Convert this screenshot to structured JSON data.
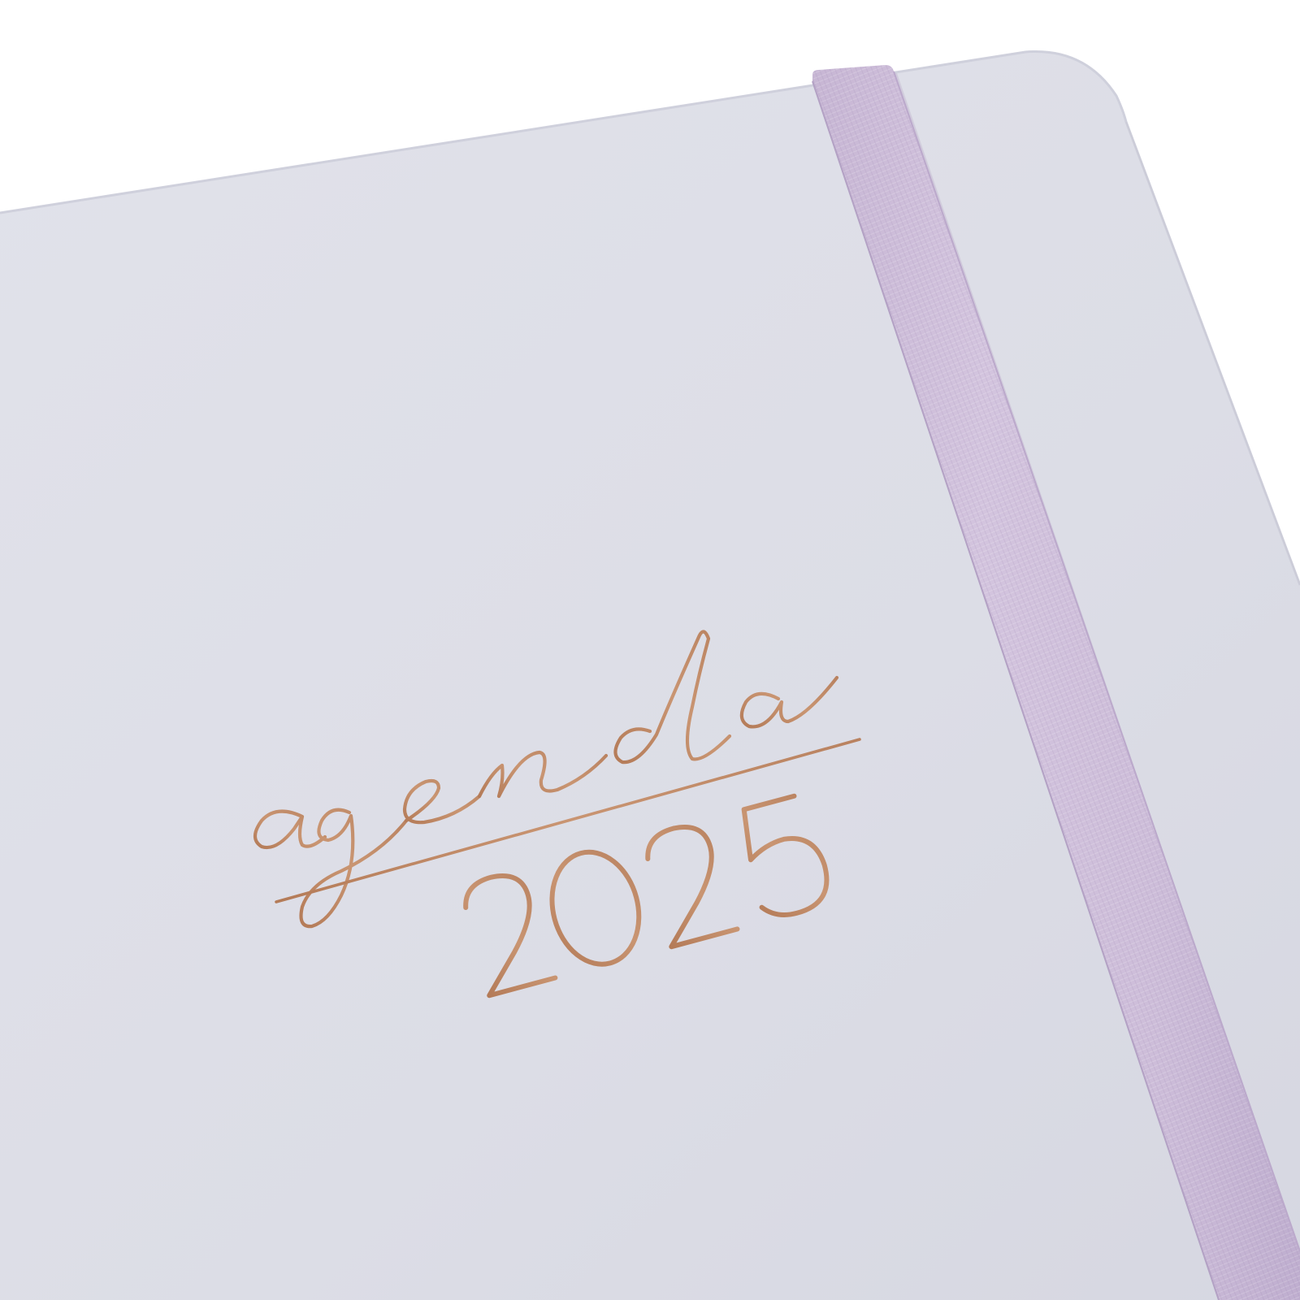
{
  "cover": {
    "title_script": "agenda",
    "year": "2025"
  },
  "colors": {
    "background": "#ffffff",
    "cover": "#dcdde6",
    "cover_edge": "#cfd0dc",
    "elastic_band": "#cdbdd9",
    "band_shadow": "#b9a9c8",
    "foil": "#c08a66"
  }
}
